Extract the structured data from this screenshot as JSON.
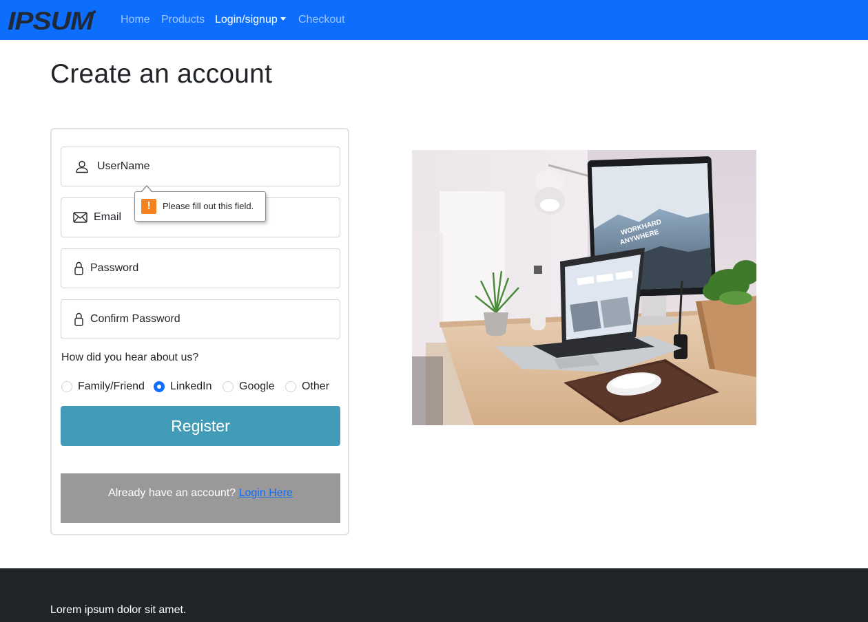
{
  "nav": {
    "logo_text": "IPSUM",
    "links": [
      {
        "label": "Home",
        "active": false
      },
      {
        "label": "Products",
        "active": false
      },
      {
        "label": "Login/signup",
        "active": true,
        "dropdown": true
      },
      {
        "label": "Checkout",
        "active": false
      }
    ],
    "bg_color": "#0d6efd"
  },
  "page": {
    "title": "Create an account"
  },
  "form": {
    "fields": [
      {
        "icon": "person-icon",
        "placeholder": "UserName"
      },
      {
        "icon": "envelope-icon",
        "placeholder": "Email"
      },
      {
        "icon": "lock-icon",
        "placeholder": "Password"
      },
      {
        "icon": "lock-icon",
        "placeholder": "Confirm Password"
      }
    ],
    "question": "How did you hear about us?",
    "options": [
      {
        "label": "Family/Friend",
        "checked": false
      },
      {
        "label": "LinkedIn",
        "checked": true
      },
      {
        "label": "Google",
        "checked": false
      },
      {
        "label": "Other",
        "checked": false
      }
    ],
    "register_label": "Register",
    "register_color": "#429bb7",
    "login_prompt": "Already have an account?",
    "login_link": "Login Here"
  },
  "tooltip": {
    "message": "Please fill out this field.",
    "icon": "warning-icon"
  },
  "footer": {
    "text": "Lorem ipsum dolor sit amet."
  }
}
